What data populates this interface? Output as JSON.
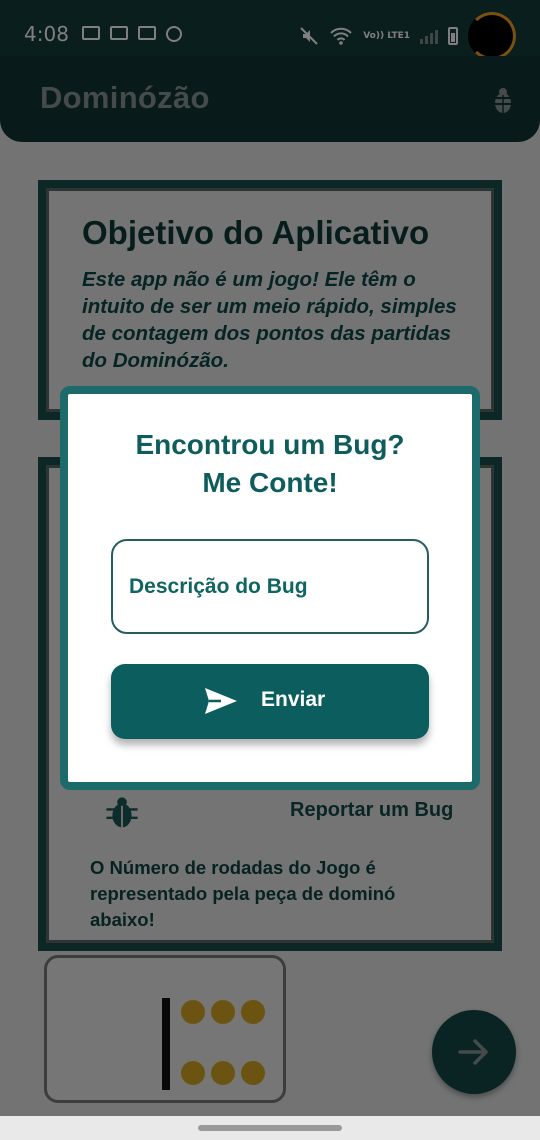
{
  "status_bar": {
    "time": "4:08",
    "network_label": "Vo)) LTE1",
    "left_icons": [
      "nfc-icon",
      "laptop-icon",
      "gallery-icon",
      "deco-icon"
    ],
    "right_icons": [
      "mute-icon",
      "wifi-icon",
      "volte-icon",
      "signal-icon",
      "battery-icon"
    ]
  },
  "app_bar": {
    "title": "Dominózão",
    "action_icon": "bug-icon"
  },
  "objective_card": {
    "title": "Objetivo do Aplicativo",
    "body": "Este app não é um jogo! Ele têm o intuito de ser um meio rápido, simples de contagem dos pontos das partidas do Dominózão."
  },
  "info_card": {
    "report_label": "Reportar um Bug",
    "rounds_note": "O Número de rodadas do Jogo é representado pela peça de dominó abaixo!"
  },
  "domino": {
    "left_pips": 0,
    "right_pips": 6,
    "pip_color": "#d6a922"
  },
  "fab": {
    "icon": "arrow-right-icon"
  },
  "dialog": {
    "title_line1": "Encontrou um Bug?",
    "title_line2": "Me Conte!",
    "input_placeholder": "Descrição do Bug",
    "input_value": "",
    "send_label": "Enviar",
    "send_icon": "send-icon"
  },
  "colors": {
    "primary": "#0c5d5e",
    "appbar": "#103433",
    "accent_pips": "#d6a922"
  }
}
